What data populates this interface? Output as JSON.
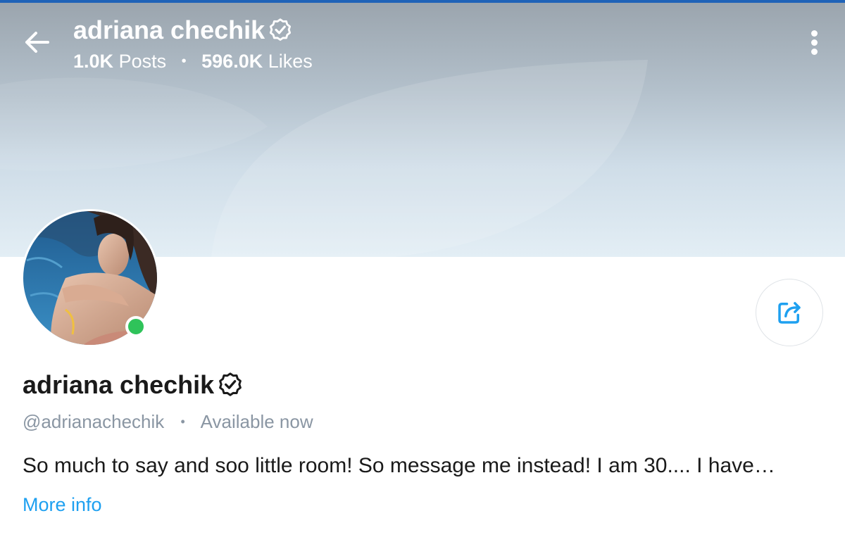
{
  "header": {
    "display_name": "adriana chechik",
    "posts_count": "1.0K",
    "posts_label": "Posts",
    "likes_count": "596.0K",
    "likes_label": "Likes",
    "separator": "•"
  },
  "profile": {
    "display_name": "adriana chechik",
    "handle": "@adrianachechik",
    "separator": "•",
    "status": "Available now",
    "bio": "So much to say and soo little room! So message me instead! I am 30.... I have…",
    "more_info_label": "More info",
    "online": true
  },
  "icons": {
    "back": "arrow-left-icon",
    "verified": "verified-badge-icon",
    "menu": "more-vertical-icon",
    "share": "share-icon"
  },
  "colors": {
    "accent": "#1ea0f0",
    "online": "#2fc35a",
    "top_bar": "#1f63b8",
    "text": "#1a1a1a",
    "muted": "#8a96a3"
  }
}
